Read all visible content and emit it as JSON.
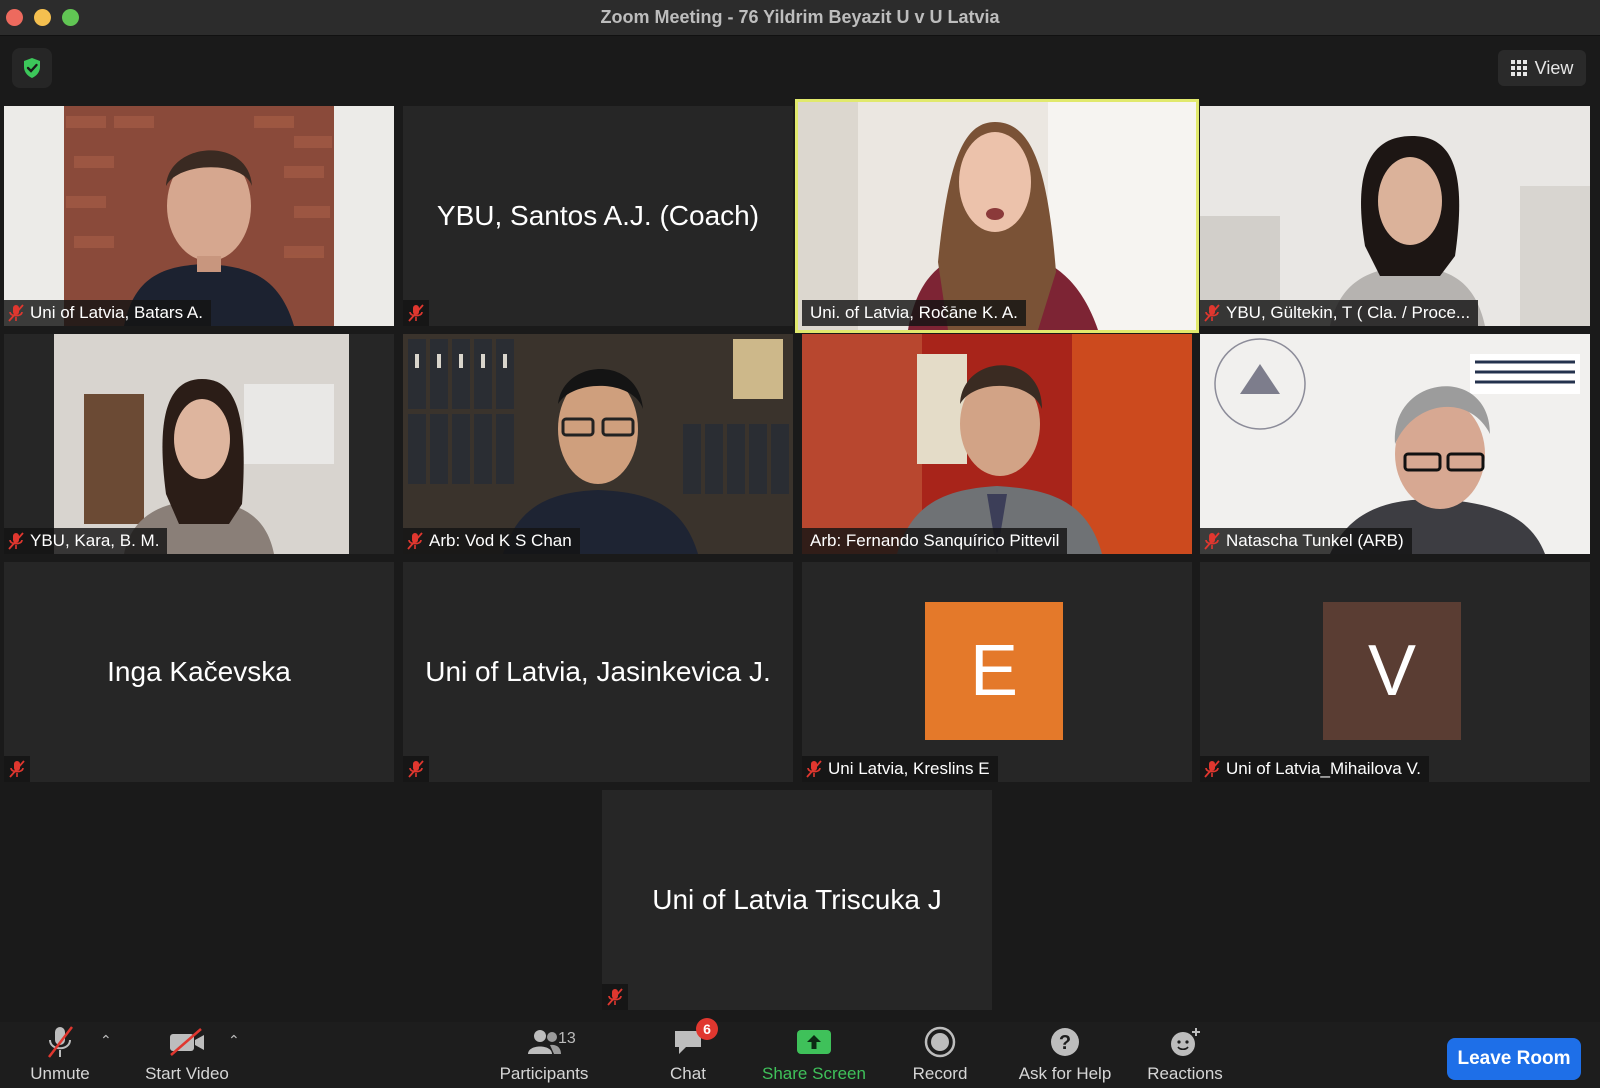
{
  "window": {
    "title": "Zoom Meeting - 76 Yildrim Beyazit U v U Latvia"
  },
  "top_bar": {
    "view_label": "View"
  },
  "tiles": [
    {
      "name": "Uni of Latvia, Batars A.",
      "muted": true
    },
    {
      "name": "YBU, Santos A.J. (Coach)",
      "muted": true
    },
    {
      "name": "Uni. of Latvia, Ročāne K. A.",
      "muted": false,
      "speaking": true
    },
    {
      "name": "YBU, Gültekin, T ( Cla. / Proce...",
      "muted": true
    },
    {
      "name": "YBU, Kara, B. M.",
      "muted": true
    },
    {
      "name": "Arb: Vod K S Chan",
      "muted": true
    },
    {
      "name": "Arb: Fernando Sanquírico Pittevil",
      "muted": false
    },
    {
      "name": "Natascha Tunkel (ARB)",
      "muted": true
    },
    {
      "name": "Inga Kačevska",
      "muted": true
    },
    {
      "name": "Uni of Latvia, Jasinkevica J.",
      "muted": true
    },
    {
      "name": "Uni Latvia, Kreslins E",
      "muted": true,
      "avatar_letter": "E",
      "avatar_color": "#e4792a"
    },
    {
      "name": "Uni of Latvia_Mihailova V.",
      "muted": true,
      "avatar_letter": "V",
      "avatar_color": "#5a3d33"
    },
    {
      "name": "Uni of Latvia Triscuka J",
      "muted": true
    }
  ],
  "toolbar": {
    "unmute": "Unmute",
    "start_video": "Start Video",
    "participants": "Participants",
    "participants_count": "13",
    "chat": "Chat",
    "chat_badge": "6",
    "share_screen": "Share Screen",
    "record": "Record",
    "ask_for_help": "Ask for Help",
    "reactions": "Reactions",
    "leave_room": "Leave Room"
  },
  "colors": {
    "share_green": "#3fc15a",
    "leave_blue": "#1e6fe8",
    "speaker_outline": "#e1e96d",
    "muted_red": "#e0372f"
  }
}
